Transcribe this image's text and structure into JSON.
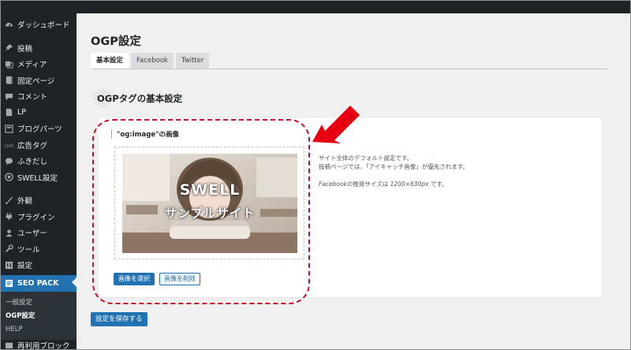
{
  "sidebar": {
    "items": [
      {
        "label": "ダッシュボード",
        "icon": "dashboard-icon"
      },
      {
        "label": "投稿",
        "icon": "pin-icon"
      },
      {
        "label": "メディア",
        "icon": "media-icon"
      },
      {
        "label": "固定ページ",
        "icon": "page-icon"
      },
      {
        "label": "コメント",
        "icon": "comment-icon"
      },
      {
        "label": "LP",
        "icon": "lp-icon"
      },
      {
        "label": "ブログパーツ",
        "icon": "blog-parts-icon"
      },
      {
        "label": "広告タグ",
        "icon": "ad-tag-icon"
      },
      {
        "label": "ふきだし",
        "icon": "balloon-icon"
      },
      {
        "label": "SWELL設定",
        "icon": "swell-icon"
      },
      {
        "label": "外観",
        "icon": "brush-icon"
      },
      {
        "label": "プラグイン",
        "icon": "plugin-icon"
      },
      {
        "label": "ユーザー",
        "icon": "user-icon"
      },
      {
        "label": "ツール",
        "icon": "wrench-icon"
      },
      {
        "label": "設定",
        "icon": "settings-icon"
      }
    ],
    "active_item": {
      "label": "SEO PACK",
      "icon": "seo-pack-icon"
    },
    "submenu": [
      "一般設定",
      "OGP設定",
      "HELP"
    ],
    "partial_item": "再利用ブロック"
  },
  "page": {
    "title": "OGP設定",
    "tabs": [
      "基本設定",
      "Facebook",
      "Twitter"
    ],
    "section_title": "OGPタグの基本設定"
  },
  "field": {
    "label": "\"og:image\"の画像",
    "preview_line1": "SWELL",
    "preview_line2": "サンプルサイト",
    "select_button": "画像を選択",
    "delete_button": "画像を削除",
    "desc_line1": "サイト全体のデフォルト設定です。",
    "desc_line2": "投稿ページでは、「アイキャッチ画像」が優先されます。",
    "note_facebook": "Facebook",
    "note_middle": "の推奨サイズは ",
    "note_size": "1200×630px",
    "note_end": " です。"
  },
  "save_button": "設定を保存する",
  "colors": {
    "accent": "#2271b1",
    "sidebar_bg": "#1d2327",
    "highlight_red": "#c8102e",
    "arrow_red": "#e60012"
  }
}
